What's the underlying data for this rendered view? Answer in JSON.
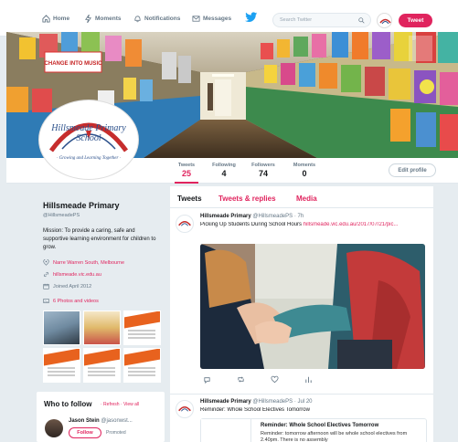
{
  "nav": {
    "home": "Home",
    "moments": "Moments",
    "notifications": "Notifications",
    "messages": "Messages",
    "search_placeholder": "Search Twitter",
    "tweet_button": "Tweet"
  },
  "logo": {
    "title": "Hillsmeade Primary School",
    "tagline": "· Growing and Learning Together ·"
  },
  "banner": {
    "sign_text": "CHANGE INTO MUSIC"
  },
  "stats": {
    "tweets_label": "Tweets",
    "tweets_value": "25",
    "following_label": "Following",
    "following_value": "4",
    "followers_label": "Followers",
    "followers_value": "74",
    "moments_label": "Moments",
    "moments_value": "0",
    "edit_profile": "Edit profile"
  },
  "profile": {
    "name": "Hillsmeade Primary",
    "handle": "@HillsmeadePS",
    "bio": "Mission: To provide a caring, safe and supportive learning environment for children to grow.",
    "location": "Narre Warren South, Melbourne",
    "website": "hillsmeade.vic.edu.au",
    "joined": "Joined April 2012",
    "photos": "6 Photos and videos"
  },
  "who_to_follow": {
    "title": "Who to follow",
    "links": "· Refresh · View all",
    "name": "Jason Stein",
    "handle": "@jasonwst...",
    "follow": "Follow",
    "promoted": "Promoted"
  },
  "timeline": {
    "tabs": [
      "Tweets",
      "Tweets & replies",
      "Media"
    ],
    "tweets": [
      {
        "name": "Hillsmeade Primary",
        "handle": "@HillsmeadePS · 7h",
        "text": "Picking Up Students During School Hours ",
        "link": "hillsmeade.vic.edu.au/2017/07/21/pic..."
      },
      {
        "name": "Hillsmeade Primary",
        "handle": "@HillsmeadePS · Jul 20",
        "text": "Reminder: Whole School Electives Tomorrow",
        "card_title": "Reminder: Whole School Electives Tomorrow",
        "card_text": "Reminder: tomorrow afternoon will be whole school electives from 2.40pm. There is no assembly"
      }
    ]
  },
  "colors": {
    "accent": "#e0245e",
    "twitter_blue": "#1da1f2",
    "background": "#e6ecf0"
  }
}
